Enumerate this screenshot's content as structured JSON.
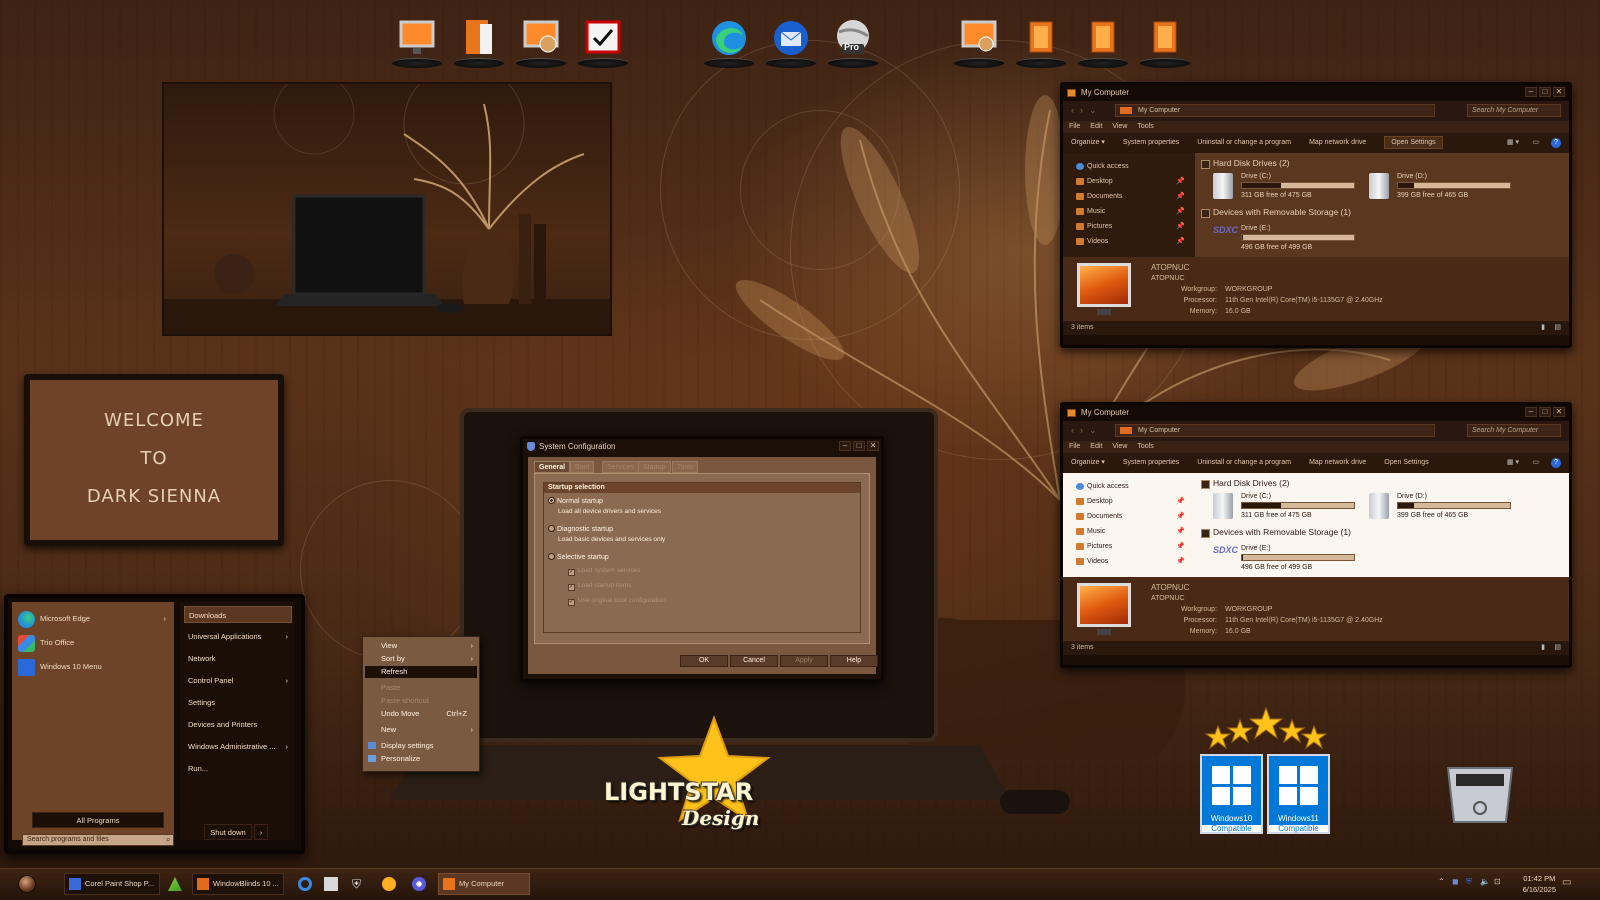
{
  "dock": {
    "left_group": [
      "computer-icon",
      "library-icon",
      "network-icon",
      "control-panel-icon"
    ],
    "center_group": [
      "edge-icon",
      "thunderbird-icon",
      "google-earth-pro-icon"
    ],
    "center_badge": "Pro",
    "right_group": [
      "computer-icon",
      "folder-icon",
      "folder-icon",
      "folder-icon"
    ]
  },
  "welcome": {
    "line1": "WELCOME",
    "line2": "TO",
    "line3": "DARK SIENNA"
  },
  "explorer_top": {
    "title": "My Computer",
    "address": "My Computer",
    "search_placeholder": "Search My Computer",
    "menu": [
      "File",
      "Edit",
      "View",
      "Tools"
    ],
    "commands": [
      "Organize ▾",
      "System properties",
      "Uninstall or change a program",
      "Map network drive"
    ],
    "open_settings": "Open Settings",
    "nav": [
      "Quick access",
      "Desktop",
      "Documents",
      "Music",
      "Pictures",
      "Videos"
    ],
    "groups": {
      "hdd": "Hard Disk Drives (2)",
      "removable": "Devices with Removable Storage (1)"
    },
    "drives": [
      {
        "name": "Drive (C:)",
        "free": "311 GB free of 475 GB",
        "used_fraction": 0.35
      },
      {
        "name": "Drive (D:)",
        "free": "399 GB free of 465 GB",
        "used_fraction": 0.14
      },
      {
        "name": "Drive (E:)",
        "free": "496 GB free of 499 GB",
        "used_fraction": 0.01
      }
    ],
    "sdxc_label": "SDXC",
    "details": {
      "computer_name": "ATOPNUC",
      "computer_sub": "ATOPNUC",
      "workgroup_label": "Workgroup:",
      "workgroup": "WORKGROUP",
      "processor_label": "Processor:",
      "processor": "11th Gen Intel(R) Core(TM) i5-1135G7 @ 2.40GHz",
      "memory_label": "Memory:",
      "memory": "16.0 GB"
    },
    "status": "3 items"
  },
  "explorer_bottom": {
    "title": "My Computer",
    "address": "My Computer",
    "search_placeholder": "Search My Computer",
    "menu": [
      "File",
      "Edit",
      "View",
      "Tools"
    ],
    "commands": [
      "Organize ▾",
      "System properties",
      "Uninstall or change a program",
      "Map network drive",
      "Open Settings"
    ],
    "nav": [
      "Quick access",
      "Desktop",
      "Documents",
      "Music",
      "Pictures",
      "Videos"
    ],
    "groups": {
      "hdd": "Hard Disk Drives (2)",
      "removable": "Devices with Removable Storage (1)"
    },
    "drives": [
      {
        "name": "Drive (C:)",
        "free": "311 GB free of 475 GB",
        "used_fraction": 0.35
      },
      {
        "name": "Drive (D:)",
        "free": "399 GB free of 465 GB",
        "used_fraction": 0.14
      },
      {
        "name": "Drive (E:)",
        "free": "496 GB free of 499 GB",
        "used_fraction": 0.01
      }
    ],
    "sdxc_label": "SDXC",
    "details": {
      "computer_name": "ATOPNUC",
      "computer_sub": "ATOPNUC",
      "workgroup_label": "Workgroup:",
      "workgroup": "WORKGROUP",
      "processor_label": "Processor:",
      "processor": "11th Gen Intel(R) Core(TM) i5-1135G7 @ 2.40GHz",
      "memory_label": "Memory:",
      "memory": "16.0 GB"
    },
    "status": "3 items"
  },
  "syscfg": {
    "title": "System Configuration",
    "tabs": [
      "General",
      "Boot",
      "Services",
      "Startup",
      "Tools"
    ],
    "group_title": "Startup selection",
    "normal": "Normal startup",
    "normal_desc": "Load all device drivers and services",
    "diagnostic": "Diagnostic startup",
    "diagnostic_desc": "Load basic devices and services only",
    "selective": "Selective startup",
    "checks": [
      "Load system services",
      "Load startup items",
      "Use original boot configuration"
    ],
    "buttons": {
      "ok": "OK",
      "cancel": "Cancel",
      "apply": "Apply",
      "help": "Help"
    }
  },
  "context_menu": {
    "view": "View",
    "sort_by": "Sort by",
    "refresh": "Refresh",
    "paste": "Paste",
    "paste_shortcut": "Paste shortcut",
    "undo_move": "Undo Move",
    "undo_shortcut": "Ctrl+Z",
    "new": "New",
    "display_settings": "Display settings",
    "personalize": "Personalize"
  },
  "start_menu": {
    "pinned": [
      "Microsoft Edge",
      "Trio Office",
      "Windows 10 Menu"
    ],
    "right": [
      "Downloads",
      "Universal Applications",
      "Network",
      "Control Panel",
      "Settings",
      "Devices and Printers",
      "Windows Administrative ...",
      "Run..."
    ],
    "all_programs": "All Programs",
    "search_placeholder": "Search programs and files",
    "shutdown": "Shut down",
    "shutdown_arrow": "›"
  },
  "taskbar": {
    "items": [
      "Corel Paint Shop P...",
      "WindowBlinds 10 ...",
      "My Computer"
    ],
    "time": "01:42 PM",
    "date": "6/16/2025"
  },
  "branding": {
    "lightstar": "LIGHTSTAR",
    "design": "Design",
    "win10": "Windows10",
    "win11": "Windows11",
    "compatible": "Compatible"
  },
  "colors": {
    "sienna_dark": "#1a0e07",
    "sienna_mid": "#5a371f",
    "sienna_light": "#7b5a42",
    "accent_orange": "#e06a1e",
    "windows_blue": "#0078d7",
    "star_gold": "#ffc21a"
  }
}
